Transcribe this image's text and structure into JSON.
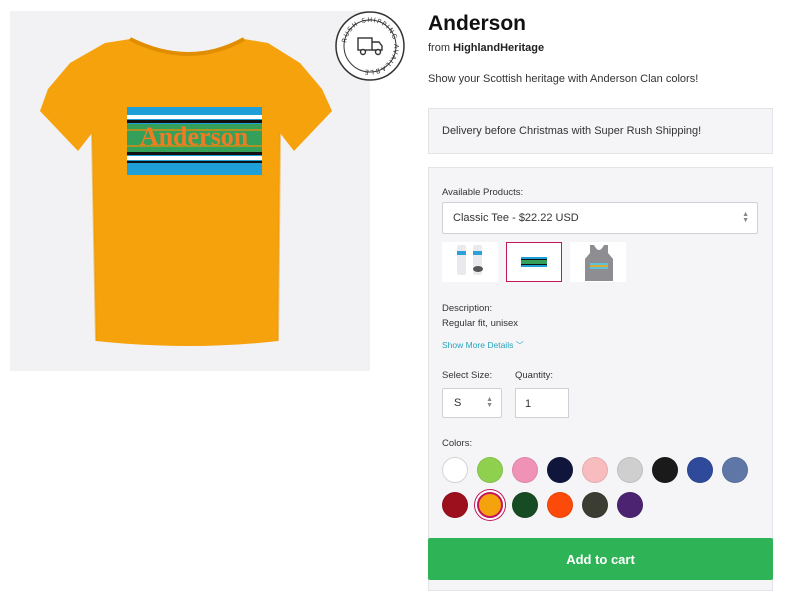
{
  "product": {
    "title": "Anderson",
    "byline_prefix": "from",
    "store": "HighlandHeritage",
    "description": "Show your Scottish heritage with Anderson Clan colors!",
    "shirt_print_text": "Anderson"
  },
  "badge": {
    "text": "RUSH SHIPPING AVAILABLE",
    "icon": "truck-icon"
  },
  "promo": {
    "text": "Delivery before Christmas with Super Rush Shipping!"
  },
  "config": {
    "available_products_label": "Available Products:",
    "product_select_value": "Classic Tee - $22.22 USD",
    "thumbnails": [
      {
        "name": "socks",
        "selected": false
      },
      {
        "name": "sticker",
        "selected": true
      },
      {
        "name": "tank-top",
        "selected": false
      }
    ],
    "description_label": "Description:",
    "description_value": "Regular fit, unisex",
    "show_more": "Show More Details",
    "size_label": "Select Size:",
    "size_value": "S",
    "quantity_label": "Quantity:",
    "quantity_value": "1",
    "colors_label": "Colors:",
    "colors": [
      "#ffffff",
      "#8fd14f",
      "#ef92b6",
      "#10163b",
      "#f8bcbf",
      "#cfcfcf",
      "#1a1a1a",
      "#2f4a9a",
      "#5e77a6",
      "#9c0f1c",
      "#f6a20c",
      "#174b23",
      "#fc4a0b",
      "#3b3d32",
      "#4b2370"
    ],
    "selected_color": "#f6a20c"
  },
  "cart": {
    "label": "Add to cart"
  },
  "accent": {
    "cart": "#2eb357",
    "selected_border": "#c2185b",
    "link": "#27a6bd"
  }
}
